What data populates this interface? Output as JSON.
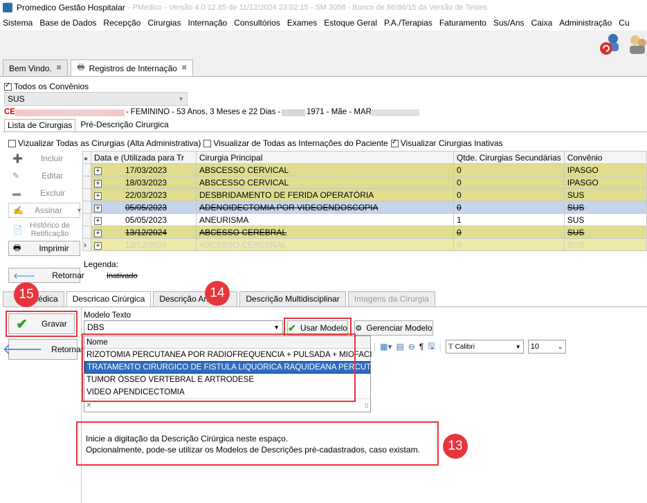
{
  "window": {
    "title": "Promedico Gestão Hospitalar",
    "title_rest": "- PMedico - Versão 4.0.12.85 de 11/12/2024 23:02:15 - SM 3058 - Banco de 86/86/15 da Versão de Testes"
  },
  "menu": [
    "Sistema",
    "Base de Dados",
    "Recepção",
    "Cirurgias",
    "Internação",
    "Consultórios",
    "Exames",
    "Estoque Geral",
    "P.A./Terapias",
    "Faturamento",
    "Sus/Ans",
    "Caixa",
    "Administração",
    "Cu"
  ],
  "tabs": [
    {
      "label": "Bem Vindo."
    },
    {
      "label": "Registros de Internação"
    }
  ],
  "filter": {
    "all_label": "Todos os Convênios",
    "convenio": "SUS"
  },
  "patient": {
    "prefix": "CE",
    "info": "- FEMININO - 53 Anos, 3 Meses e 22 Dias -",
    "year": "1971 - Mãe - MAR"
  },
  "subtabs": [
    "Lista de Cirurgias",
    "Pré-Descrição Cirurgica"
  ],
  "options": {
    "opt1": "Vizualizar Todas as Cirurgias (Alta Administrativa)",
    "opt2": "Visualizar de Todas as Internações do Paciente",
    "opt3": "Visualizar Cirurgias Inativas"
  },
  "side": {
    "incluir": "Incluir",
    "editar": "Editar",
    "excluir": "Excluir",
    "assinar": "Assinar",
    "historico1": "Histórico de",
    "historico2": "Retificação",
    "imprimir": "Imprimir",
    "retornar": "Retornar"
  },
  "grid": {
    "headers": [
      "Data e (Utilizada para Tr",
      "Cirurgia Principal",
      "Qtde. Cirurgias Secundárias",
      "Convênio"
    ],
    "rows": [
      [
        "17/03/2023",
        "ABSCESSO CERVICAL",
        "0",
        "IPASGO"
      ],
      [
        "18/03/2023",
        "ABSCESSO CERVICAL",
        "0",
        "IPASGO"
      ],
      [
        "22/03/2023",
        "DESBRIDAMENTO DE FERIDA OPERATÓRIA",
        "0",
        "SUS"
      ],
      [
        "05/05/2023",
        "ADENOIDECTOMIA POR VIDEOENDOSCOPIA",
        "0",
        "SUS"
      ],
      [
        "05/05/2023",
        "ANEURISMA",
        "1",
        "SUS"
      ],
      [
        "13/12/2024",
        "ABCESSO CEREBRAL",
        "0",
        "SUS"
      ],
      [
        "13/12/2024",
        "ABCESSO CEREBRAL",
        "0",
        "SUS"
      ]
    ]
  },
  "legend": {
    "label": "Legenda:",
    "inativado": "Inativado"
  },
  "tabs2": [
    "Médica",
    "Descricao Cirúrgica",
    "Descrição Anes",
    "Descrição Multidisciplinar",
    "Imagens da Cirurgia"
  ],
  "desc": {
    "gravar": "Gravar",
    "retornar": "Retornar",
    "modelo_label": "Modelo Texto",
    "modelo_value": "DBS",
    "usar": "Usar Modelo",
    "gerenciar": "Gerenciar Modelo",
    "font": "Calibri",
    "size": "10",
    "list_header": "Nome",
    "list": [
      "RIZOTOMIA PERCUTANEA POR RADIOFREQUENCIA + PULSADA + MIOFACI",
      "TRATAMENTO CIRURGICO DE FISTULA LIQUORICA RAQUIDEANA PERCUTA",
      "TUMOR ÓSSEO VERTEBRAL E ARTRODESE",
      "VIDEO APENDICECTOMIA"
    ],
    "clear": "×",
    "hint1": "Inicie a digitação da Descrição Cirúrgica neste espaço.",
    "hint2": "Opcionalmente, pode-se utilizar os Modelos de Descrições pré-cadastrados, caso existam."
  },
  "badges": {
    "b13": "13",
    "b14": "14",
    "b15": "15"
  },
  "colors": {
    "red": "#e8353c",
    "yellow_row": "#e0dd8f",
    "blue_row": "#c6d5ec",
    "select": "#2f6bbf"
  }
}
